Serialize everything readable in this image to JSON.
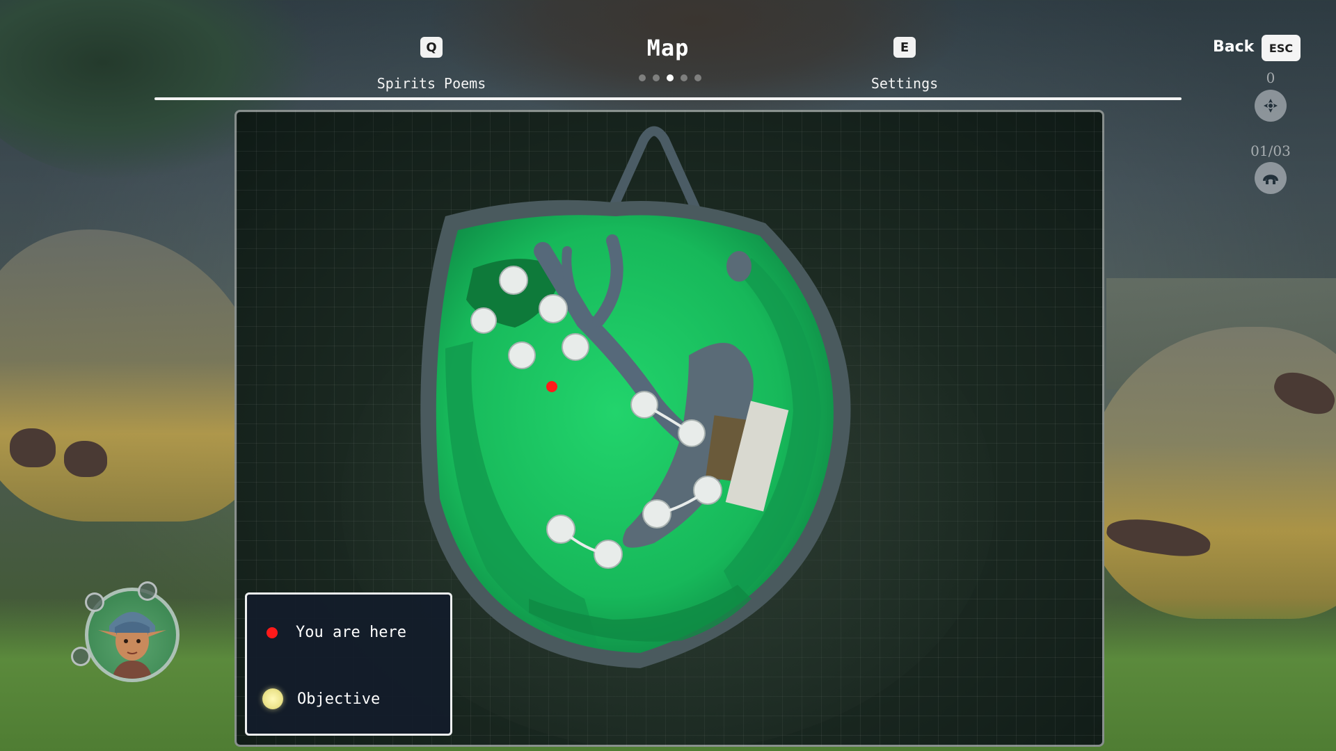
{
  "nav": {
    "prev_key": "Q",
    "prev_label": "Spirits Poems",
    "title": "Map",
    "next_key": "E",
    "next_label": "Settings",
    "pages_total": 5,
    "pages_active_index": 2
  },
  "back": {
    "label": "Back",
    "key": "ESC"
  },
  "counters": {
    "spirits_count": "0",
    "spirits_icon": "spirit-swirl-icon",
    "poems_count": "01/03",
    "poems_icon": "poem-wave-icon"
  },
  "legend": {
    "you_are_here": "You are here",
    "objective": "Objective",
    "you_are_here_color": "#ff1a1a",
    "objective_color": "#eee690"
  },
  "colors": {
    "map_grass": "#1ec765",
    "map_grass_dark": "#139c4f",
    "map_path": "#5a6b77",
    "map_bg": "#1c2a22"
  }
}
